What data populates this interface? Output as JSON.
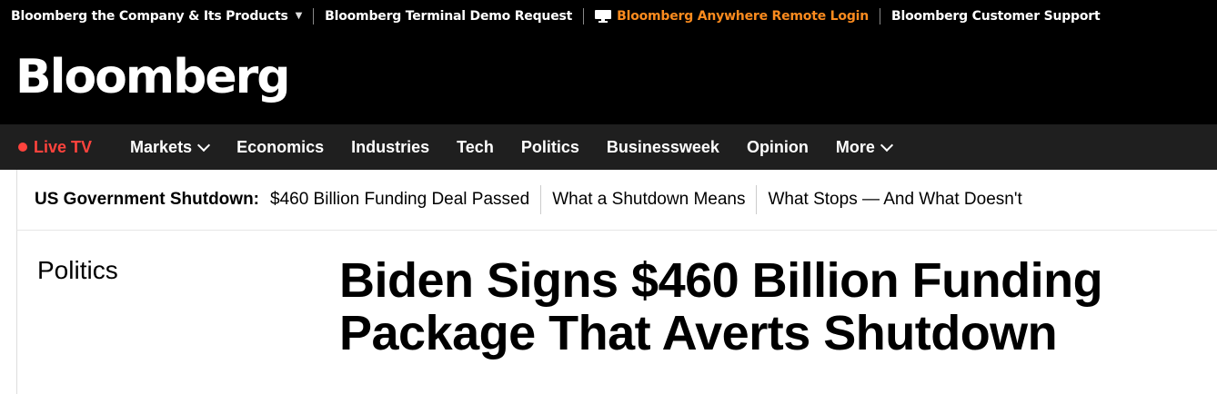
{
  "topbar": {
    "company": "Bloomberg the Company & Its Products",
    "terminal": "Bloomberg Terminal Demo Request",
    "anywhere": "Bloomberg Anywhere Remote Login",
    "support": "Bloomberg Customer Support",
    "accent": "#fb8b1e"
  },
  "brand": {
    "logo": "Bloomberg"
  },
  "nav": {
    "live": "Live TV",
    "live_color": "#ff433d",
    "items": [
      "Markets",
      "Economics",
      "Industries",
      "Tech",
      "Politics",
      "Businessweek",
      "Opinion",
      "More"
    ]
  },
  "strip": {
    "title": "US Government Shutdown:",
    "links": [
      "$460 Billion Funding Deal Passed",
      "What a Shutdown Means",
      "What Stops — And What Doesn't"
    ]
  },
  "article": {
    "section": "Politics",
    "headline": "Biden Signs $460 Billion Funding Package That Averts Shutdown"
  }
}
